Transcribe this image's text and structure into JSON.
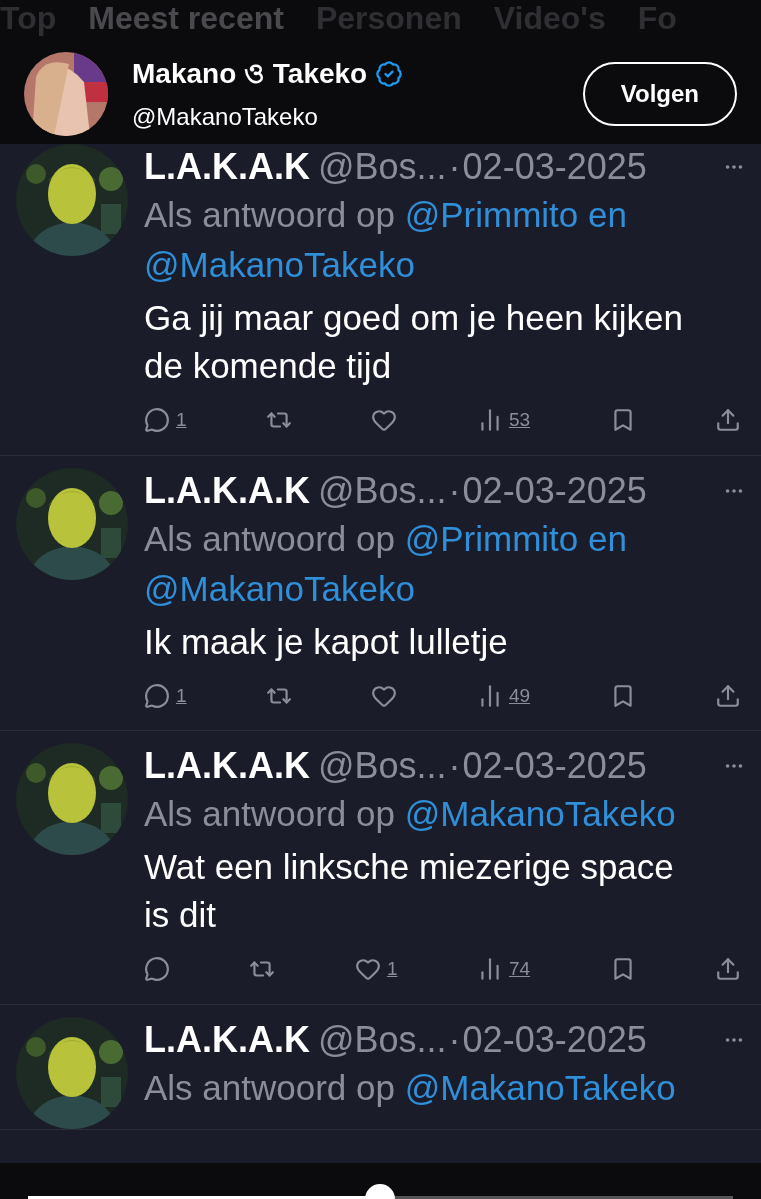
{
  "tabs": [
    {
      "label": "Top",
      "selected": false
    },
    {
      "label": "Meest recent",
      "selected": true
    },
    {
      "label": "Personen",
      "selected": false
    },
    {
      "label": "Video's",
      "selected": false
    },
    {
      "label": "Fo",
      "selected": false
    }
  ],
  "profile_bar": {
    "name": "Makano ও Takeko",
    "verified": true,
    "handle": "@MakanoTakeko",
    "button": "Volgen"
  },
  "tweets": [
    {
      "author": "L.A.K.A.K",
      "handle": "@Bos...",
      "sep": "·",
      "date": "02-03-2025",
      "reply_prefix": "Als antwoord op",
      "mentions": [
        "@Primmito en",
        "@MakanoTakeko"
      ],
      "text": "Ga jij maar goed om je heen kijken de komende tijd",
      "replies": "1",
      "views": "53"
    },
    {
      "author": "L.A.K.A.K",
      "handle": "@Bos...",
      "sep": "·",
      "date": "02-03-2025",
      "reply_prefix": "Als antwoord op",
      "mentions": [
        "@Primmito en",
        "@MakanoTakeko"
      ],
      "text": "Ik maak je kapot lulletje",
      "replies": "1",
      "views": "49"
    },
    {
      "author": "L.A.K.A.K",
      "handle": "@Bos...",
      "sep": "·",
      "date": "02-03-2025",
      "reply_prefix": "Als antwoord op",
      "mentions": [
        "@MakanoTakeko"
      ],
      "text": "Wat een linksche miezerige space is dit",
      "likes": "1",
      "views": "74"
    },
    {
      "author": "L.A.K.A.K",
      "handle": "@Bos...",
      "sep": "·",
      "date": "02-03-2025",
      "reply_prefix": "Als antwoord op",
      "mentions": [
        "@MakanoTakeko"
      ]
    }
  ]
}
